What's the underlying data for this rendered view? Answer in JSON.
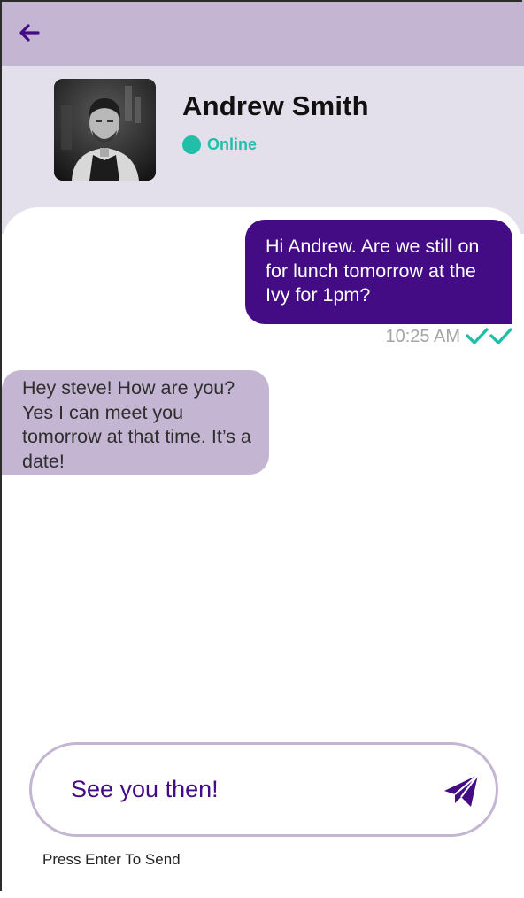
{
  "header": {
    "back_icon": "arrow-left-icon",
    "background": "#c4b5d2"
  },
  "contact": {
    "name": "Andrew Smith",
    "status": "Online",
    "status_color": "#21bfa8",
    "avatar": "avatar-photo"
  },
  "messages": [
    {
      "direction": "outgoing",
      "text": "Hi Andrew. Are we still on for lunch tomorrow at the Ivy for 1pm?",
      "time": "10:25 AM",
      "read_icon": "double-check-icon",
      "color": "#430c84"
    },
    {
      "direction": "incoming",
      "text": "Hey steve! How are you? Yes I can meet you tomorrow at that time. It’s a date!",
      "color": "#c4b5d2"
    }
  ],
  "composer": {
    "value": "See you then!",
    "send_icon": "paper-plane-icon",
    "hint": "Press Enter To Send"
  }
}
